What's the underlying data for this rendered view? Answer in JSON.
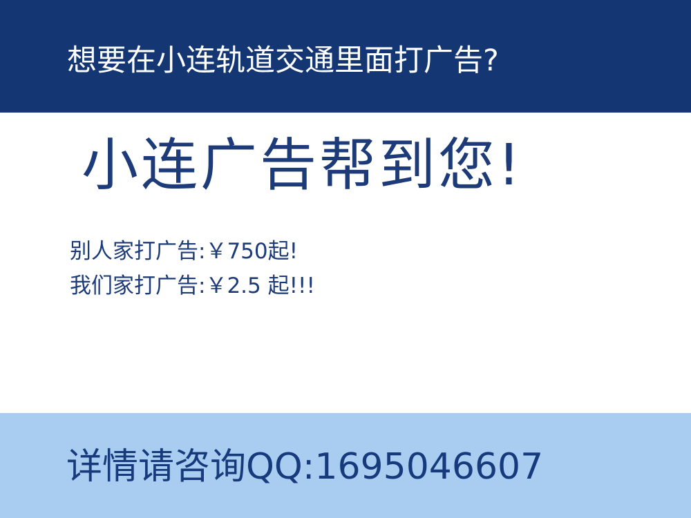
{
  "top_banner": {
    "text": "想要在小连轨道交通里面打广告?"
  },
  "headline": {
    "text": "小连广告帮到您!"
  },
  "prices": [
    {
      "text": "别人家打广告:￥750起!"
    },
    {
      "text": "我们家打广告:￥2.5 起!!!"
    }
  ],
  "bottom_banner": {
    "contact": "详情请咨询QQ:1695046607"
  },
  "colors": {
    "dark_blue": "#143774",
    "text_blue": "#1c3b78",
    "light_blue": "#a8cdf0",
    "white": "#ffffff"
  }
}
